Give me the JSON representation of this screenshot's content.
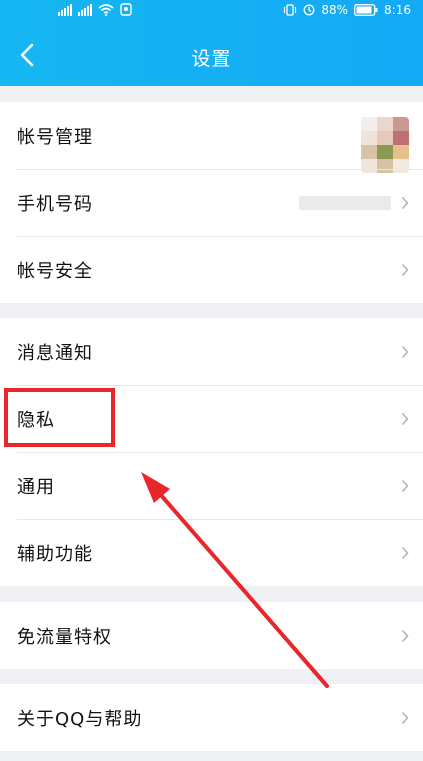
{
  "status_bar": {
    "battery_percent": "88%",
    "time": "8:16"
  },
  "header": {
    "title": "设置"
  },
  "groups": [
    {
      "items": [
        {
          "label": "帐号管理"
        },
        {
          "label": "手机号码"
        },
        {
          "label": "帐号安全"
        }
      ]
    },
    {
      "items": [
        {
          "label": "消息通知"
        },
        {
          "label": "隐私"
        },
        {
          "label": "通用"
        },
        {
          "label": "辅助功能"
        }
      ]
    },
    {
      "items": [
        {
          "label": "免流量特权"
        }
      ]
    },
    {
      "items": [
        {
          "label": "关于QQ与帮助"
        }
      ]
    }
  ],
  "colors": {
    "header_start": "#16b7f2",
    "header_end": "#14a9f5",
    "highlight": "#e8262b",
    "page_bg": "#eef0f4"
  }
}
